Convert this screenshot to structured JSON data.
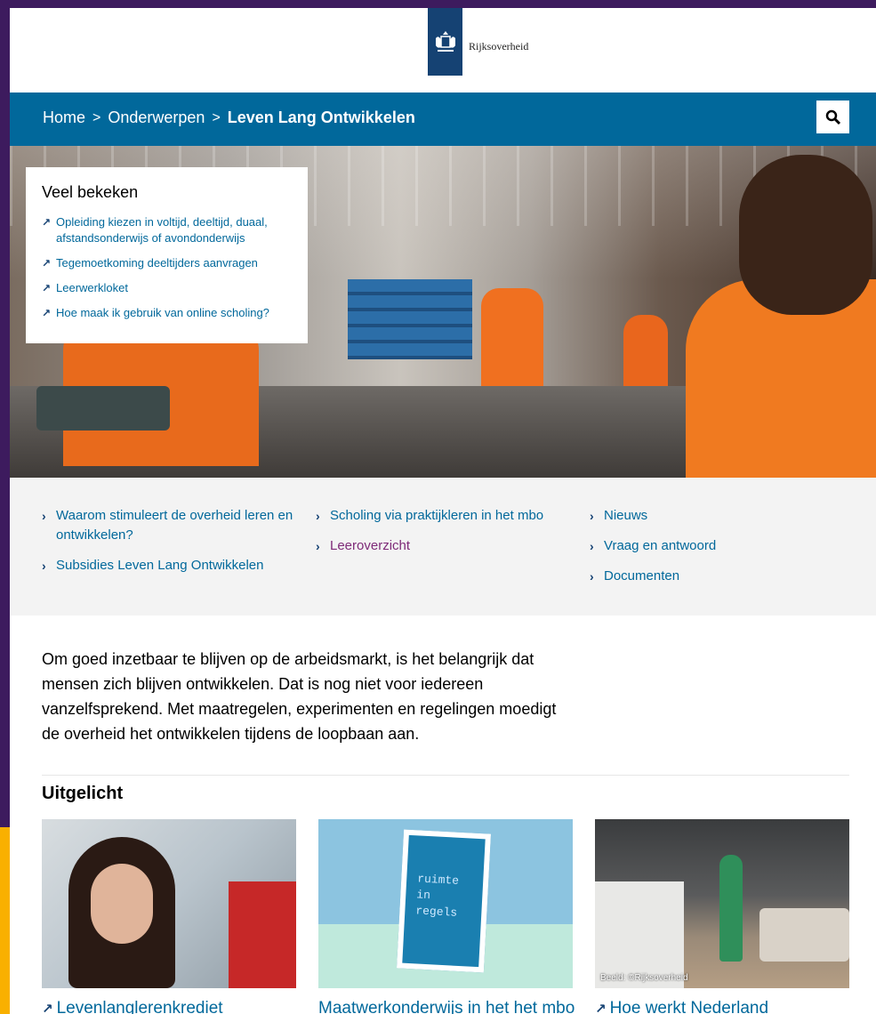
{
  "header": {
    "logo_text": "Rijksoverheid"
  },
  "breadcrumb": {
    "home": "Home",
    "separator": ">",
    "topics": "Onderwerpen",
    "current": "Leven Lang Ontwikkelen"
  },
  "search": {
    "icon": "search-icon"
  },
  "popular": {
    "title": "Veel bekeken",
    "items": [
      "Opleiding kiezen in voltijd, deeltijd, duaal, afstandsonderwijs of avondonderwijs",
      "Tegemoetkoming deeltijders aanvragen",
      "Leerwerkloket",
      "Hoe maak ik gebruik van online scholing?"
    ]
  },
  "links": {
    "col1": [
      "Waarom stimuleert de overheid leren en ontwikkelen?",
      "Subsidies Leven Lang Ontwikkelen"
    ],
    "col2": [
      "Scholing via praktijkleren in het mbo",
      "Leeroverzicht"
    ],
    "col3": [
      "Nieuws",
      "Vraag en antwoord",
      "Documenten"
    ]
  },
  "intro": "Om goed inzetbaar te blijven op de arbeidsmarkt, is het belangrijk dat mensen zich blijven ontwikkelen. Dat is nog niet voor iedereen vanzelfsprekend. Met maatregelen, experimenten en regelingen moedigt de overheid het ontwikkelen tijdens de loopbaan aan.",
  "featured": {
    "title": "Uitgelicht",
    "cards": [
      {
        "title": "Levenlanglerenkrediet"
      },
      {
        "title": "Maatwerkonderwijs in het het mbo",
        "book_text": "ruimte in regels"
      },
      {
        "title": "Hoe werkt Nederland",
        "credit": "Beeld: ©Rijksoverheid"
      }
    ]
  },
  "colors": {
    "primary": "#01689b",
    "visited": "#7e2a78",
    "accent": "#f9b000",
    "purple": "#3d1b5e"
  }
}
